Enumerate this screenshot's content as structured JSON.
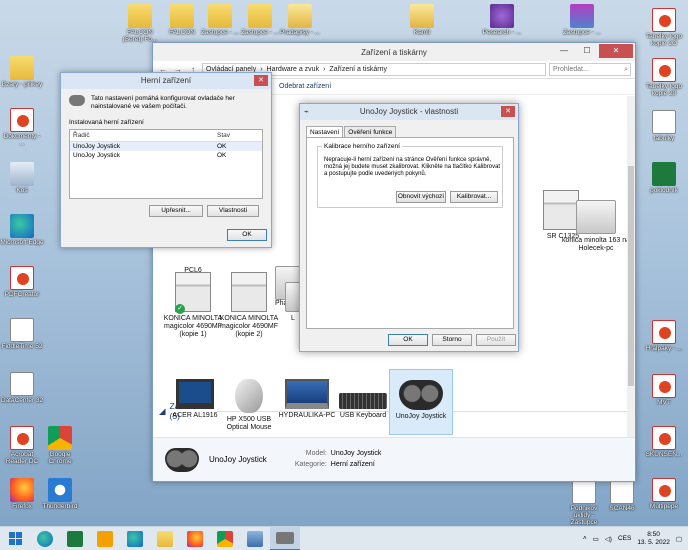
{
  "desktop": {
    "top_icons": [
      "FALCON (Seret) Fo...",
      "FALCON",
      "Zastupce - ...",
      "Zastupce - ...",
      "Pradapisy - ...",
      "Kamil",
      "Pesearch - ...",
      "Zastupce - ...",
      "Tabelky logo kopie 2O"
    ],
    "left_icons": [
      "Bzary - pilikey",
      "Dokumenty - ...",
      "Koš",
      "Microsoft Edge",
      "PDFCreator",
      "FiddleTime 52",
      "DataCenter 32",
      "Acrobat Reader DC",
      "Google Chrome",
      "Firefox",
      "Thunderbird"
    ],
    "right_icons": [
      "Tabelky logo kopie 20",
      "tabulky",
      "poklodník",
      "Hrálpaky - ...",
      "MVT",
      "SKUNSEN...",
      "Multipepe"
    ],
    "bottom_icons": [
      "Podnikov úklidy - Zástupce",
      "SCAN46"
    ]
  },
  "explorer": {
    "title": "Zařízení a tiskárny",
    "breadcrumb": [
      "Ovládací panely",
      "Hardware a zvuk",
      "Zařízení a tiskárny"
    ],
    "search_placeholder": "Prohledat...",
    "toolbar_action": "Odebrat zařízení",
    "printers": [
      {
        "name": "PCL6",
        "status": ""
      },
      {
        "name": "Phas",
        "status": ""
      },
      {
        "name": "SR C1325",
        "status": ""
      },
      {
        "name": "konica minolta 163 na Holecek-pc",
        "status": ""
      },
      {
        "name": "KONICA MINOLTA magicolor 4690MF (kopie 1)",
        "status": "default"
      },
      {
        "name": "KONICA MINOLTA magicolor 4690MF (kopie 2)",
        "status": ""
      },
      {
        "name": "L",
        "status": ""
      }
    ],
    "devices_section": "Zařízení (5)",
    "devices": [
      {
        "name": "ACER AL1916",
        "kind": "monitor"
      },
      {
        "name": "HP X500 USB Optical Mouse",
        "kind": "mouse"
      },
      {
        "name": "HYDRAULIKA-PC",
        "kind": "laptop"
      },
      {
        "name": "USB Keyboard",
        "kind": "keyboard"
      },
      {
        "name": "UnoJoy Joystick",
        "kind": "gamepad",
        "selected": true
      }
    ],
    "details": {
      "name": "UnoJoy Joystick",
      "model_label": "Model:",
      "model_value": "UnoJoy Joystick",
      "category_label": "Kategorie:",
      "category_value": "Herní zařízení"
    }
  },
  "game_dialog": {
    "title": "Herní zařízení",
    "intro": "Tato nastavení pomáhá konfigurovat ovladače her nainstalované ve vašem počítači.",
    "group_label": "Instalovaná herní zařízení",
    "columns": [
      "Řadič",
      "Stav"
    ],
    "rows": [
      {
        "controller": "UnoJoy Joystick",
        "status": "OK"
      },
      {
        "controller": "UnoJoy Joystick",
        "status": "OK"
      }
    ],
    "btn_advanced": "Upřesnit...",
    "btn_properties": "Vlastnosti",
    "btn_ok": "OK"
  },
  "props_dialog": {
    "title": "UnoJoy Joystick - vlastnosti",
    "tabs": [
      "Nastavení",
      "Ověření funkce"
    ],
    "group_title": "Kalibrace herního zařízení",
    "description": "Nepracuje-li herní zařízení na stránce Ověření funkce správně, možná jej budete muset zkalibrovat. Klikněte na tlačítko Kalibrovat a postupujte podle uvedených pokynů.",
    "btn_reset": "Obnovit výchozí",
    "btn_calibrate": "Kalibrovat...",
    "btn_ok": "OK",
    "btn_cancel": "Storno",
    "btn_apply": "Použít"
  },
  "taskbar": {
    "language": "CES",
    "time": "8:50",
    "date": "13. 5. 2022"
  }
}
